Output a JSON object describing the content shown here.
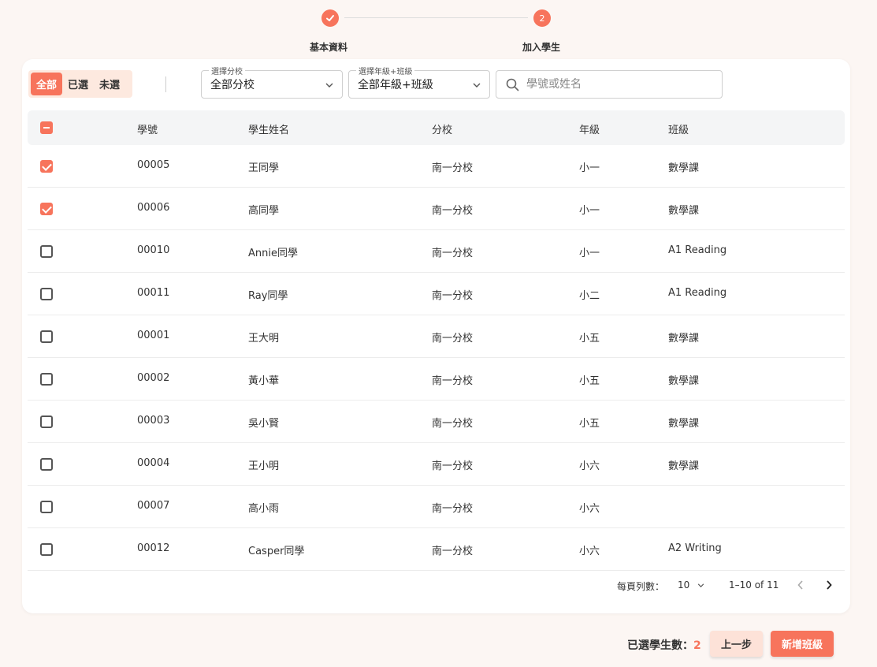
{
  "stepper": {
    "step1_label": "基本資料",
    "step2_number": "2",
    "step2_label": "加入學生"
  },
  "filters": {
    "segments": [
      "全部",
      "已選",
      "未選"
    ],
    "active_segment": "全部",
    "branch": {
      "label": "選擇分校",
      "value": "全部分校"
    },
    "grade_class": {
      "label": "選擇年級+班級",
      "value": "全部年級+班級"
    },
    "search_placeholder": "學號或姓名"
  },
  "table": {
    "columns": [
      "學號",
      "學生姓名",
      "分校",
      "年級",
      "班級"
    ],
    "rows": [
      {
        "checked": true,
        "id": "00005",
        "name": "王同學",
        "branch": "南一分校",
        "grade": "小一",
        "class": "數學課"
      },
      {
        "checked": true,
        "id": "00006",
        "name": "高同學",
        "branch": "南一分校",
        "grade": "小一",
        "class": "數學課"
      },
      {
        "checked": false,
        "id": "00010",
        "name": "Annie同學",
        "branch": "南一分校",
        "grade": "小一",
        "class": "A1 Reading"
      },
      {
        "checked": false,
        "id": "00011",
        "name": "Ray同學",
        "branch": "南一分校",
        "grade": "小二",
        "class": "A1 Reading"
      },
      {
        "checked": false,
        "id": "00001",
        "name": "王大明",
        "branch": "南一分校",
        "grade": "小五",
        "class": "數學課"
      },
      {
        "checked": false,
        "id": "00002",
        "name": "黃小華",
        "branch": "南一分校",
        "grade": "小五",
        "class": "數學課"
      },
      {
        "checked": false,
        "id": "00003",
        "name": "吳小賢",
        "branch": "南一分校",
        "grade": "小五",
        "class": "數學課"
      },
      {
        "checked": false,
        "id": "00004",
        "name": "王小明",
        "branch": "南一分校",
        "grade": "小六",
        "class": "數學課"
      },
      {
        "checked": false,
        "id": "00007",
        "name": "高小雨",
        "branch": "南一分校",
        "grade": "小六",
        "class": ""
      },
      {
        "checked": false,
        "id": "00012",
        "name": "Casper同學",
        "branch": "南一分校",
        "grade": "小六",
        "class": "A2 Writing"
      }
    ]
  },
  "pagination": {
    "rows_per_page_label": "每頁列數：",
    "rows_per_page": "10",
    "range": "1–10 of 11"
  },
  "footer": {
    "selected_label": "已選學生數：",
    "selected_count": "2",
    "prev_button": "上一步",
    "create_button": "新增班級"
  },
  "colors": {
    "accent": "#f7745c",
    "accent_light": "#fde2d8",
    "background": "#fcf6f3"
  }
}
